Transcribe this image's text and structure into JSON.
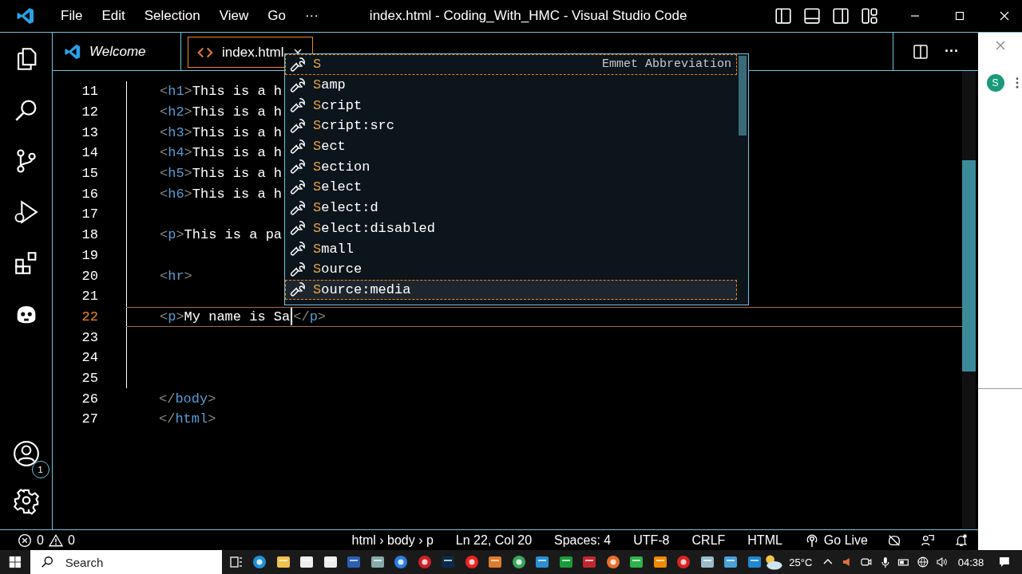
{
  "window": {
    "title": "index.html - Coding_With_HMC - Visual Studio Code"
  },
  "menu": [
    "File",
    "Edit",
    "Selection",
    "View",
    "Go",
    "···"
  ],
  "tabs": [
    {
      "label": "Welcome",
      "selected": false,
      "kind": "welcome"
    },
    {
      "label": "index.html",
      "selected": true,
      "kind": "html"
    }
  ],
  "editor_actions": {
    "more": "···"
  },
  "account_badge": "1",
  "editor": {
    "lines": [
      {
        "number": "11",
        "current": false,
        "indented": true,
        "segments": [
          {
            "kind": "punct",
            "text": "<"
          },
          {
            "kind": "tag",
            "text": "h1"
          },
          {
            "kind": "punct",
            "text": ">"
          },
          {
            "kind": "text",
            "text": "This is a h"
          }
        ]
      },
      {
        "number": "12",
        "current": false,
        "indented": true,
        "segments": [
          {
            "kind": "punct",
            "text": "<"
          },
          {
            "kind": "tag",
            "text": "h2"
          },
          {
            "kind": "punct",
            "text": ">"
          },
          {
            "kind": "text",
            "text": "This is a h"
          }
        ]
      },
      {
        "number": "13",
        "current": false,
        "indented": true,
        "segments": [
          {
            "kind": "punct",
            "text": "<"
          },
          {
            "kind": "tag",
            "text": "h3"
          },
          {
            "kind": "punct",
            "text": ">"
          },
          {
            "kind": "text",
            "text": "This is a h"
          }
        ]
      },
      {
        "number": "14",
        "current": false,
        "indented": true,
        "segments": [
          {
            "kind": "punct",
            "text": "<"
          },
          {
            "kind": "tag",
            "text": "h4"
          },
          {
            "kind": "punct",
            "text": ">"
          },
          {
            "kind": "text",
            "text": "This is a h"
          }
        ]
      },
      {
        "number": "15",
        "current": false,
        "indented": true,
        "segments": [
          {
            "kind": "punct",
            "text": "<"
          },
          {
            "kind": "tag",
            "text": "h5"
          },
          {
            "kind": "punct",
            "text": ">"
          },
          {
            "kind": "text",
            "text": "This is a h"
          }
        ]
      },
      {
        "number": "16",
        "current": false,
        "indented": true,
        "segments": [
          {
            "kind": "punct",
            "text": "<"
          },
          {
            "kind": "tag",
            "text": "h6"
          },
          {
            "kind": "punct",
            "text": ">"
          },
          {
            "kind": "text",
            "text": "This is a h"
          }
        ]
      },
      {
        "number": "17",
        "current": false,
        "indented": true
      },
      {
        "number": "18",
        "current": false,
        "indented": true,
        "segments": [
          {
            "kind": "punct",
            "text": "<"
          },
          {
            "kind": "tag",
            "text": "p"
          },
          {
            "kind": "punct",
            "text": ">"
          },
          {
            "kind": "text",
            "text": "This is a pa"
          }
        ]
      },
      {
        "number": "19",
        "current": false,
        "indented": true
      },
      {
        "number": "20",
        "current": false,
        "indented": true,
        "segments": [
          {
            "kind": "punct",
            "text": "<"
          },
          {
            "kind": "tag",
            "text": "hr"
          },
          {
            "kind": "punct",
            "text": ">"
          }
        ]
      },
      {
        "number": "21",
        "current": false,
        "indented": true
      },
      {
        "number": "22",
        "current": true,
        "indented": true,
        "segments": [
          {
            "kind": "punct",
            "text": "<"
          },
          {
            "kind": "tag",
            "text": "p"
          },
          {
            "kind": "punct",
            "text": ">"
          },
          {
            "kind": "text",
            "text": "My name is Sa"
          },
          {
            "kind": "cursor"
          },
          {
            "kind": "punct",
            "text": "</"
          },
          {
            "kind": "tag",
            "text": "p"
          },
          {
            "kind": "punct",
            "text": ">"
          }
        ]
      },
      {
        "number": "23",
        "current": false,
        "indented": true
      },
      {
        "number": "24",
        "current": false,
        "indented": true
      },
      {
        "number": "25",
        "current": false,
        "indented": true
      },
      {
        "number": "26",
        "current": false,
        "indented": false,
        "segments": [
          {
            "kind": "punct",
            "text": "</"
          },
          {
            "kind": "tag",
            "text": "body"
          },
          {
            "kind": "punct",
            "text": ">"
          }
        ]
      },
      {
        "number": "27",
        "current": false,
        "indented": false,
        "segments": [
          {
            "kind": "punct",
            "text": "</"
          },
          {
            "kind": "tag",
            "text": "html"
          },
          {
            "kind": "punct",
            "text": ">"
          }
        ]
      }
    ]
  },
  "suggestions": {
    "detail": "Emmet Abbreviation",
    "items": [
      {
        "label": "**S**",
        "selected": true,
        "hovered": false
      },
      {
        "label": "**S**amp",
        "selected": false,
        "hovered": false
      },
      {
        "label": "**S**cript",
        "selected": false,
        "hovered": false
      },
      {
        "label": "**S**cript:src",
        "selected": false,
        "hovered": false
      },
      {
        "label": "**S**ect",
        "selected": false,
        "hovered": false
      },
      {
        "label": "**S**ection",
        "selected": false,
        "hovered": false
      },
      {
        "label": "**S**elect",
        "selected": false,
        "hovered": false
      },
      {
        "label": "**S**elect:d",
        "selected": false,
        "hovered": false
      },
      {
        "label": "**S**elect:disabled",
        "selected": false,
        "hovered": false
      },
      {
        "label": "**S**mall",
        "selected": false,
        "hovered": false
      },
      {
        "label": "**S**ource",
        "selected": false,
        "hovered": false
      },
      {
        "label": "**S**ource:media",
        "selected": false,
        "hovered": true
      }
    ]
  },
  "status_bar": {
    "errors": "0",
    "warnings": "0",
    "breadcrumb": "html › body › p",
    "items": [
      "Ln 22, Col 20",
      "Spaces: 4",
      "UTF-8",
      "CRLF",
      "HTML"
    ],
    "go_live": "Go Live"
  },
  "browser": {
    "avatar": "S"
  },
  "taskbar": {
    "search": {
      "placeholder": "Search"
    },
    "weather": "25°C",
    "time": "04:38"
  }
}
